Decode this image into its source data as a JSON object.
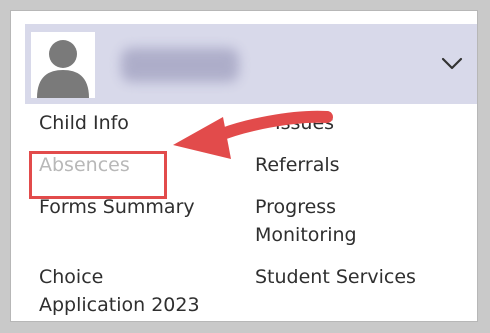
{
  "menu": {
    "header": {
      "avatar_icon": "user-avatar-icon",
      "toggle_icon": "chevron-down-icon"
    },
    "left_items": [
      {
        "label": "Child Info"
      },
      {
        "label": "Absences",
        "state": "highlighted-disabled"
      },
      {
        "label": "Forms Summary"
      },
      {
        "label": "Choice"
      },
      {
        "label": "Application 2023"
      }
    ],
    "right_items": [
      {
        "label": "Issues"
      },
      {
        "label": "Referrals"
      },
      {
        "label": "Progress"
      },
      {
        "label": "Monitoring"
      },
      {
        "label": "Student Services"
      }
    ]
  },
  "annotation": {
    "box_color": "#e24b4b",
    "arrow_color": "#e24b4b",
    "target": "Absences"
  }
}
